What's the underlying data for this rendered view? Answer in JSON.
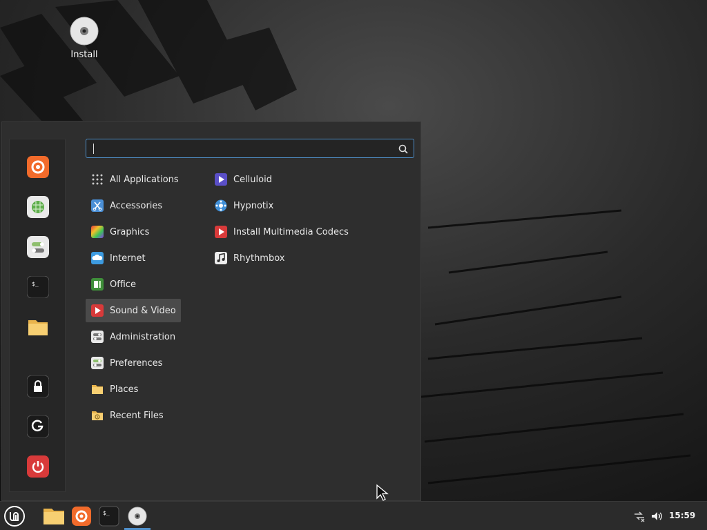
{
  "desktop": {
    "icons": [
      {
        "label": "Install",
        "icon": "disc-icon"
      }
    ]
  },
  "menu": {
    "search": {
      "value": "",
      "placeholder": "",
      "icon": "search-icon"
    },
    "favorites": [
      {
        "name": "Firefox",
        "icon": "firefox-icon"
      },
      {
        "name": "Software Manager",
        "icon": "software-manager-icon"
      },
      {
        "name": "System Settings",
        "icon": "settings-icon"
      },
      {
        "name": "Terminal",
        "icon": "terminal-icon"
      },
      {
        "name": "Files",
        "icon": "folder-icon"
      },
      {
        "name": "Lock Screen",
        "icon": "lock-icon"
      },
      {
        "name": "Log Out",
        "icon": "logout-icon"
      },
      {
        "name": "Quit",
        "icon": "power-icon"
      }
    ],
    "categories": [
      {
        "label": "All Applications",
        "icon": "grid-icon"
      },
      {
        "label": "Accessories",
        "icon": "accessories-icon"
      },
      {
        "label": "Graphics",
        "icon": "graphics-icon"
      },
      {
        "label": "Internet",
        "icon": "internet-icon"
      },
      {
        "label": "Office",
        "icon": "office-icon"
      },
      {
        "label": "Sound & Video",
        "icon": "sound-video-icon",
        "selected": true
      },
      {
        "label": "Administration",
        "icon": "administration-icon"
      },
      {
        "label": "Preferences",
        "icon": "preferences-icon"
      },
      {
        "label": "Places",
        "icon": "folder-icon"
      },
      {
        "label": "Recent Files",
        "icon": "recent-files-icon"
      }
    ],
    "apps": [
      {
        "label": "Celluloid",
        "icon": "celluloid-icon"
      },
      {
        "label": "Hypnotix",
        "icon": "hypnotix-icon"
      },
      {
        "label": "Install Multimedia Codecs",
        "icon": "codecs-icon"
      },
      {
        "label": "Rhythmbox",
        "icon": "rhythmbox-icon"
      }
    ]
  },
  "taskbar": {
    "launchers": [
      "menu-icon",
      "folder-icon",
      "firefox-icon",
      "terminal-icon",
      "disc-icon"
    ],
    "tray": [
      "network-disconnected-icon",
      "volume-icon"
    ],
    "clock": "15:59"
  },
  "colors": {
    "accent": "#4f8fc9",
    "menu_bg": "#2e2e2e",
    "panel_bg": "#2b2b2b",
    "red": "#d83a3a",
    "firefox": "#f26b2b"
  }
}
